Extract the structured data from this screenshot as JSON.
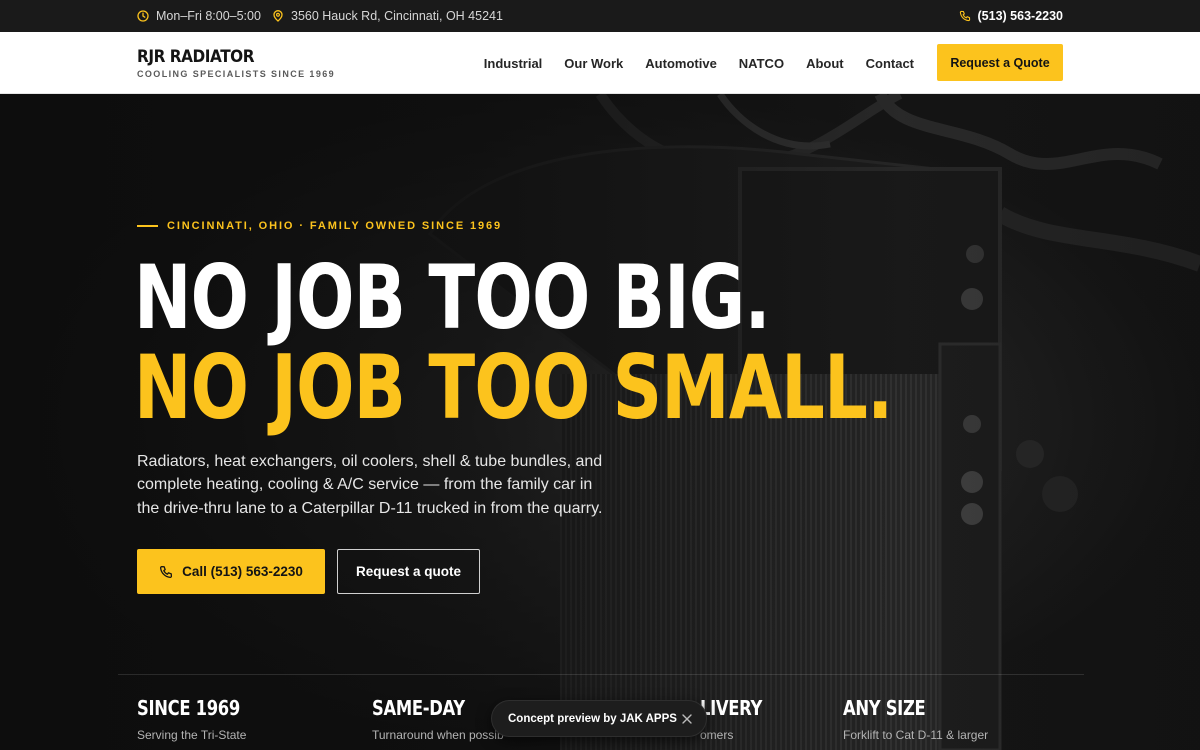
{
  "topbar": {
    "hours": "Mon–Fri 8:00–5:00",
    "address": "3560 Hauck Rd, Cincinnati, OH 45241",
    "phone": "(513) 563-2230"
  },
  "brand": {
    "name": "RJR RADIATOR",
    "tagline": "COOLING SPECIALISTS SINCE 1969"
  },
  "nav": {
    "links": [
      "Industrial",
      "Our Work",
      "Automotive",
      "NATCO",
      "About",
      "Contact"
    ],
    "cta": "Request a Quote"
  },
  "hero": {
    "eyebrow": "CINCINNATI, OHIO · FAMILY OWNED SINCE 1969",
    "headline_1": "NO JOB TOO BIG.",
    "headline_2": "NO JOB TOO SMALL.",
    "lede": "Radiators, heat exchangers, oil coolers, shell & tube bundles, and complete heating, cooling & A/C service — from the family car in the drive-thru lane to a Caterpillar D-11 trucked in from the quarry.",
    "cta_call": "Call (513) 563-2230",
    "cta_quote": "Request a quote"
  },
  "stats": [
    {
      "title": "SINCE 1969",
      "sub": "Serving the Tri-State"
    },
    {
      "title": "SAME-DAY",
      "sub": "Turnaround when possib"
    },
    {
      "title": "LIVERY",
      "sub": "omers"
    },
    {
      "title": "ANY SIZE",
      "sub": "Forklift to Cat D-11 & larger"
    }
  ],
  "toast": {
    "text": "Concept preview by JAK APPS"
  },
  "colors": {
    "accent": "#fcc31d",
    "dark": "#141414",
    "white": "#ffffff"
  }
}
